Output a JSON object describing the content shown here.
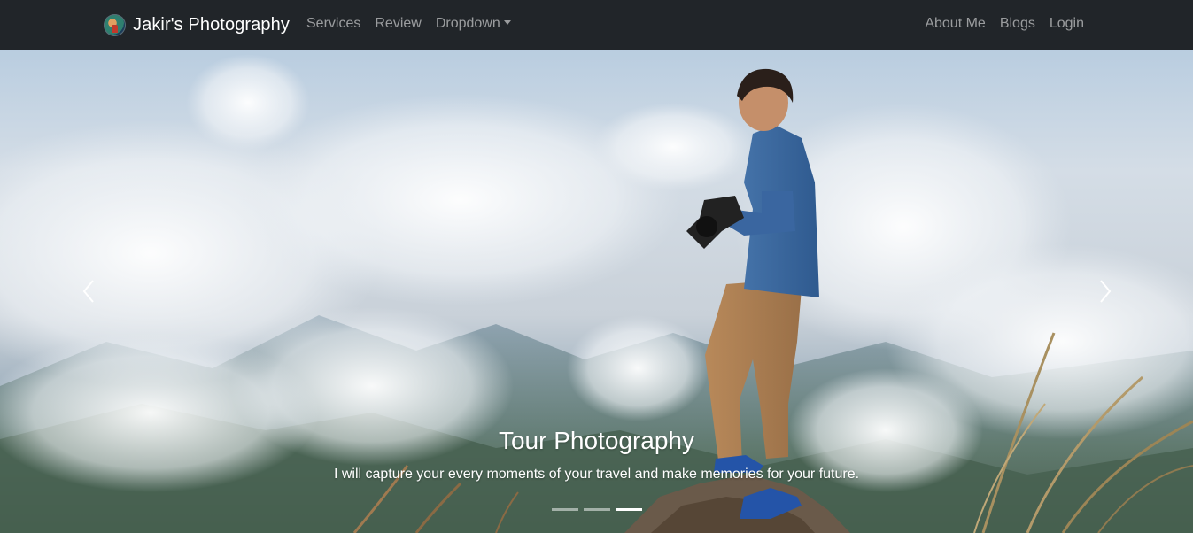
{
  "navbar": {
    "brand": "Jakir's Photography",
    "links_left": [
      {
        "label": "Services"
      },
      {
        "label": "Review"
      },
      {
        "label": "Dropdown"
      }
    ],
    "links_right": [
      {
        "label": "About Me"
      },
      {
        "label": "Blogs"
      },
      {
        "label": "Login"
      }
    ]
  },
  "carousel": {
    "caption_title": "Tour Photography",
    "caption_text": "I will capture your every moments of your travel and make memories for your future.",
    "slide_count": 3,
    "active_slide": 3
  },
  "icons": [
    "brand-logo-icon",
    "chevron-left-icon",
    "chevron-right-icon",
    "caret-down-icon"
  ],
  "colors": {
    "navbar_bg": "#212529",
    "nav_link": "rgba(255,255,255,0.55)",
    "brand": "#ffffff",
    "caption": "#ffffff"
  }
}
